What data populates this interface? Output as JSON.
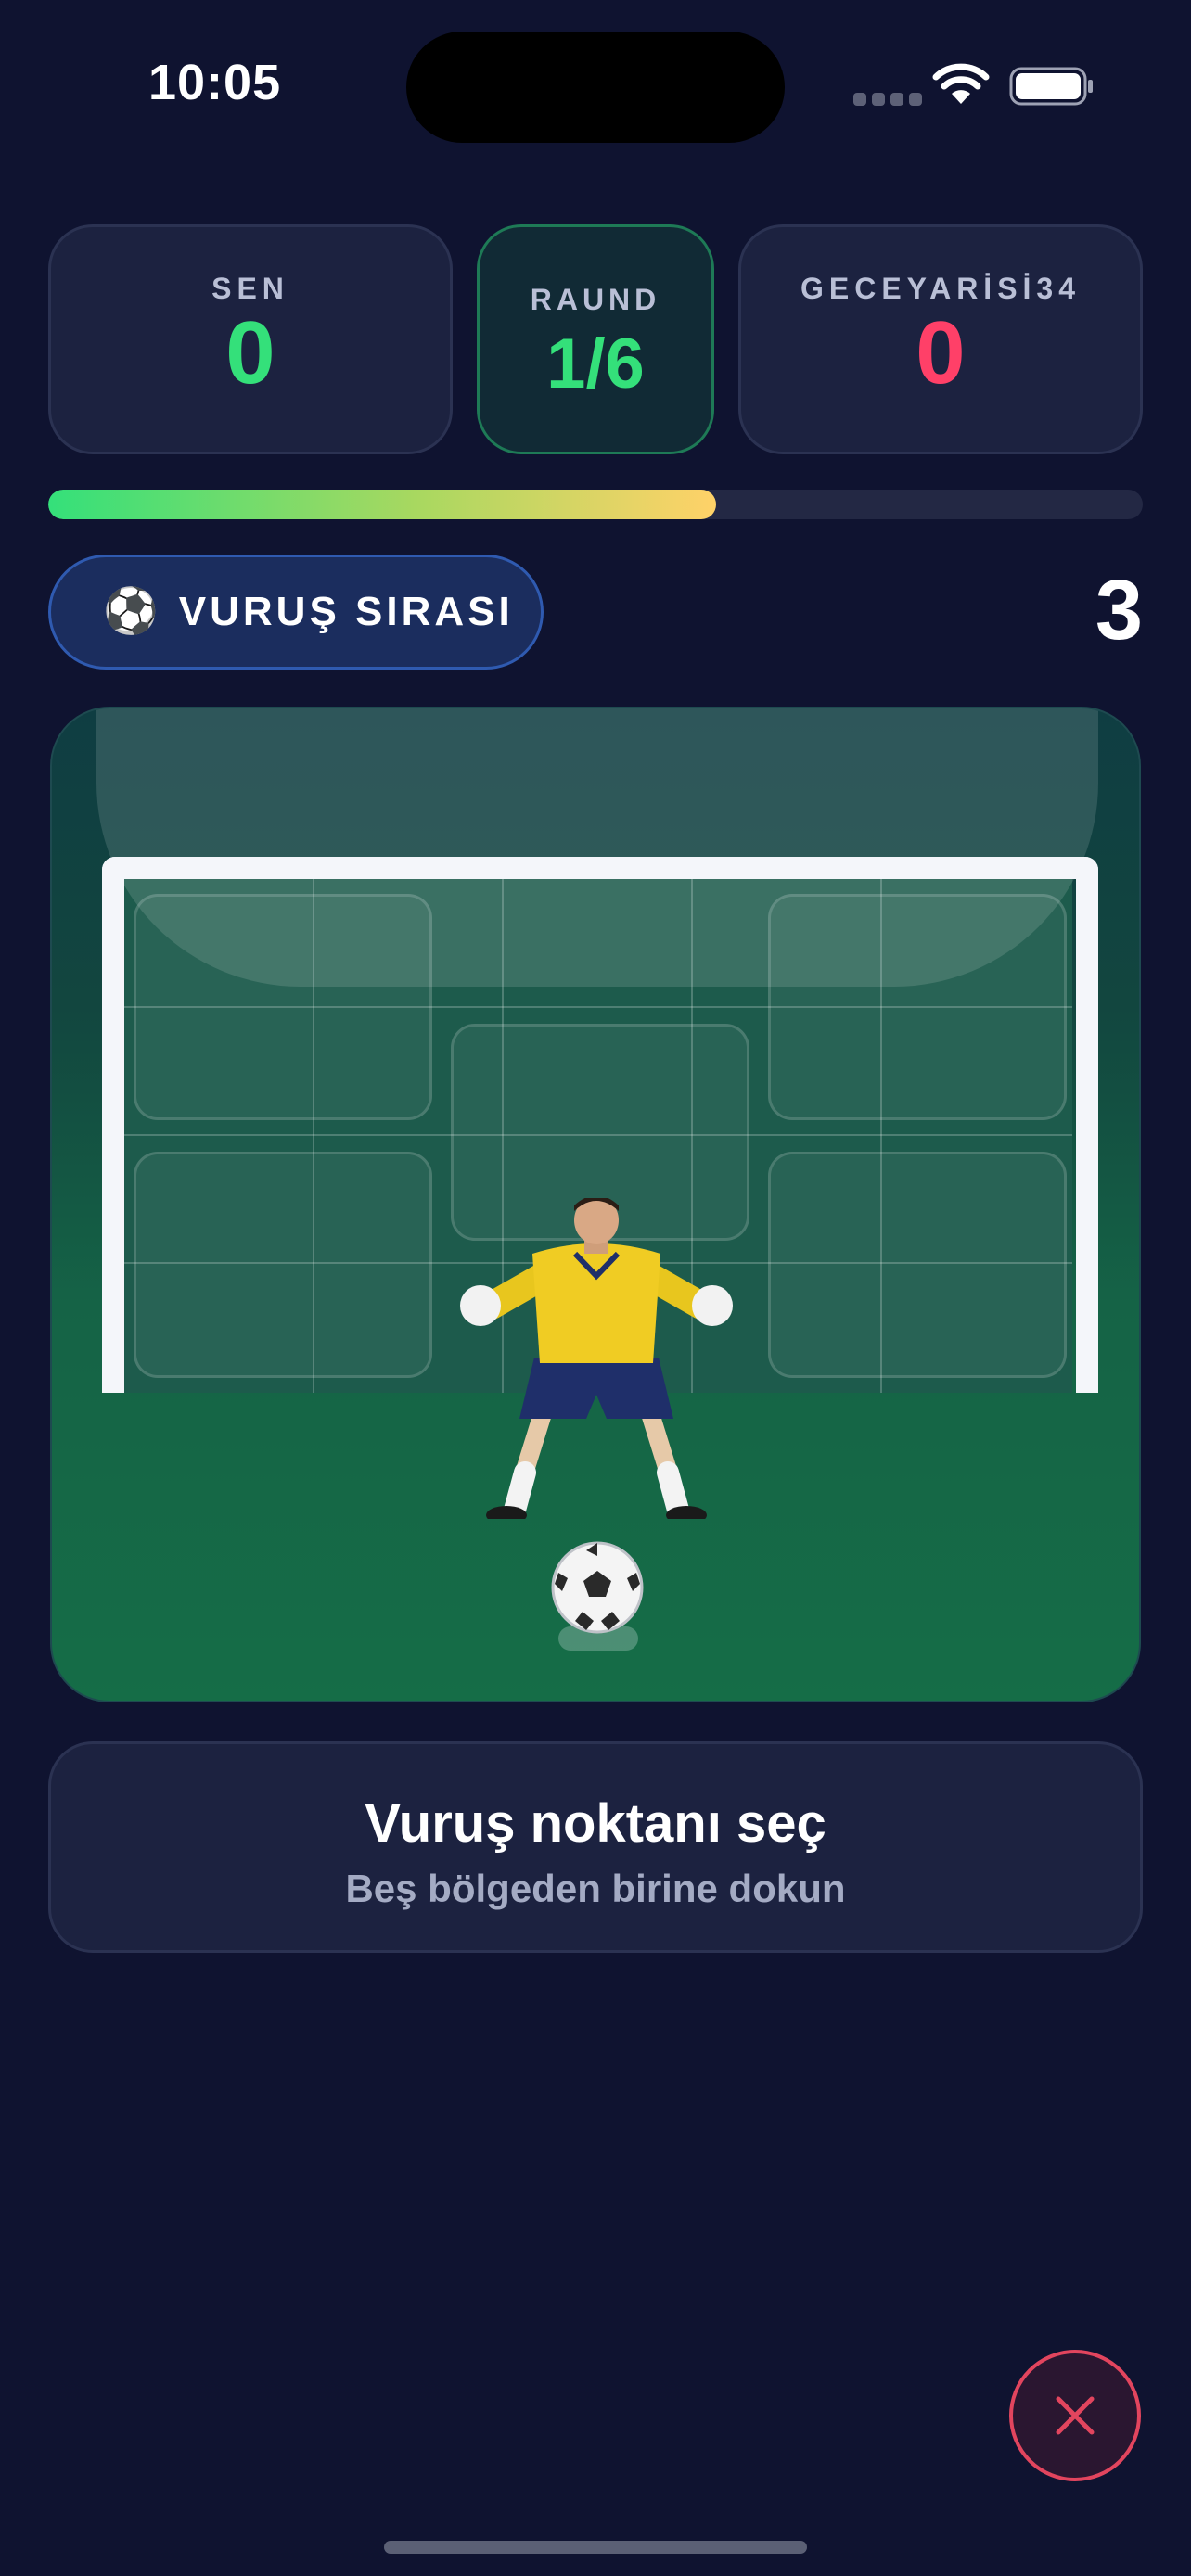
{
  "status_bar": {
    "time": "10:05"
  },
  "scoreboard": {
    "player": {
      "label": "SEN",
      "score": "0"
    },
    "round": {
      "label": "RAUND",
      "value": "1/6"
    },
    "opponent": {
      "label": "GECEYARİSİ34",
      "score": "0"
    }
  },
  "round_progress": 0.61,
  "turn": {
    "icon": "⚽",
    "label": "VURUŞ SIRASI",
    "timer": "3"
  },
  "pitch": {
    "zones": [
      "top-left",
      "top-right",
      "center",
      "bottom-left",
      "bottom-right"
    ]
  },
  "instruction": {
    "title": "Vuruş noktanı seç",
    "subtitle": "Beş bölgeden birine dokun"
  },
  "colors": {
    "background": "#0f1330",
    "player_score": "#34e07a",
    "opponent_score": "#ff4068",
    "close_accent": "#e2455e"
  },
  "icons": {
    "close": "close-icon",
    "wifi": "wifi-icon",
    "battery": "battery-icon"
  }
}
